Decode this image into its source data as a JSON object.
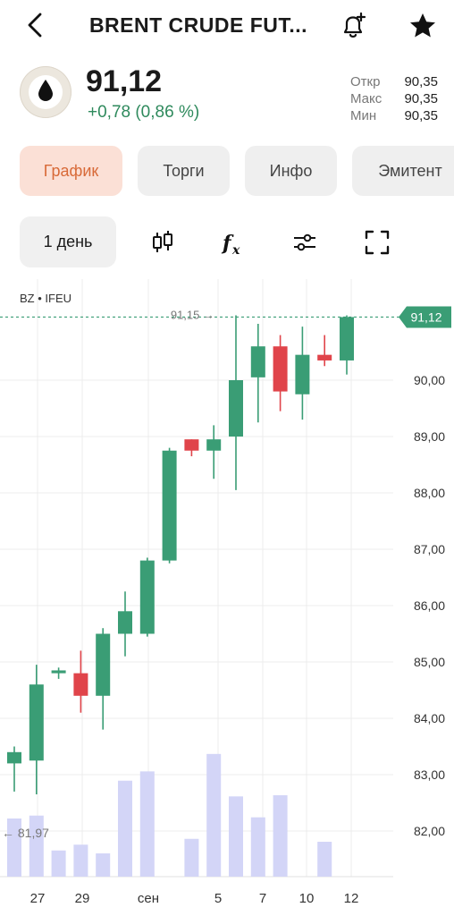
{
  "header": {
    "title": "BRENT CRUDE FUT...",
    "back_icon": "chevron-left-icon",
    "alert_icon": "bell-plus-icon",
    "favorite_icon": "star-icon"
  },
  "quote": {
    "price": "91,12",
    "change": "+0,78 (0,86 %)",
    "stats": [
      {
        "label": "Откр",
        "value": "90,35"
      },
      {
        "label": "Макс",
        "value": "90,35"
      },
      {
        "label": "Мин",
        "value": "90,35"
      }
    ]
  },
  "tabs": [
    {
      "label": "График",
      "active": true
    },
    {
      "label": "Торги",
      "active": false
    },
    {
      "label": "Инфо",
      "active": false
    },
    {
      "label": "Эмитент",
      "active": false
    }
  ],
  "toolbar": {
    "period": "1 день",
    "icons": [
      "candles-icon",
      "function-icon",
      "sliders-icon",
      "fullscreen-icon"
    ]
  },
  "colors": {
    "up": "#3a9d75",
    "down": "#e0444a",
    "volume": "#d3d5f7",
    "accent": "#d86a38"
  },
  "chart_data": {
    "type": "candlestick",
    "ticker": "BZ • IFEU",
    "x_labels": [
      "27",
      "29",
      "сен",
      "5",
      "7",
      "10",
      "12"
    ],
    "y_ticks": [
      "82,00",
      "83,00",
      "84,00",
      "85,00",
      "86,00",
      "87,00",
      "88,00",
      "89,00",
      "90,00"
    ],
    "ylim": [
      81.0,
      91.9
    ],
    "last_price_label": "91,12",
    "max_marker": "91,15 →",
    "min_marker": "← 81,97",
    "candles": [
      {
        "o": 83.2,
        "h": 83.5,
        "l": 82.7,
        "c": 83.4
      },
      {
        "o": 83.25,
        "h": 84.95,
        "l": 82.65,
        "c": 84.6
      },
      {
        "o": 84.8,
        "h": 84.9,
        "l": 84.7,
        "c": 84.85
      },
      {
        "o": 84.8,
        "h": 85.2,
        "l": 84.1,
        "c": 84.4
      },
      {
        "o": 84.4,
        "h": 85.6,
        "l": 83.8,
        "c": 85.5
      },
      {
        "o": 85.5,
        "h": 86.25,
        "l": 85.1,
        "c": 85.9
      },
      {
        "o": 85.5,
        "h": 86.85,
        "l": 85.45,
        "c": 86.8
      },
      {
        "o": 86.8,
        "h": 88.8,
        "l": 86.75,
        "c": 88.75
      },
      {
        "o": 88.95,
        "h": 88.95,
        "l": 88.65,
        "c": 88.75
      },
      {
        "o": 88.75,
        "h": 89.2,
        "l": 88.25,
        "c": 88.95
      },
      {
        "o": 89.0,
        "h": 91.15,
        "l": 88.05,
        "c": 90.0
      },
      {
        "o": 90.05,
        "h": 91.0,
        "l": 89.25,
        "c": 90.6
      },
      {
        "o": 90.6,
        "h": 90.8,
        "l": 89.45,
        "c": 89.8
      },
      {
        "o": 89.75,
        "h": 90.95,
        "l": 89.3,
        "c": 90.45
      },
      {
        "o": 90.45,
        "h": 90.8,
        "l": 90.25,
        "c": 90.35
      },
      {
        "o": 90.35,
        "h": 91.15,
        "l": 90.1,
        "c": 91.12
      }
    ],
    "volumes": [
      1.0,
      1.05,
      0.45,
      0.55,
      0.4,
      1.65,
      1.81,
      0.0,
      0.65,
      2.11,
      1.38,
      1.02,
      1.4,
      0.0,
      0.6,
      0.0
    ]
  }
}
